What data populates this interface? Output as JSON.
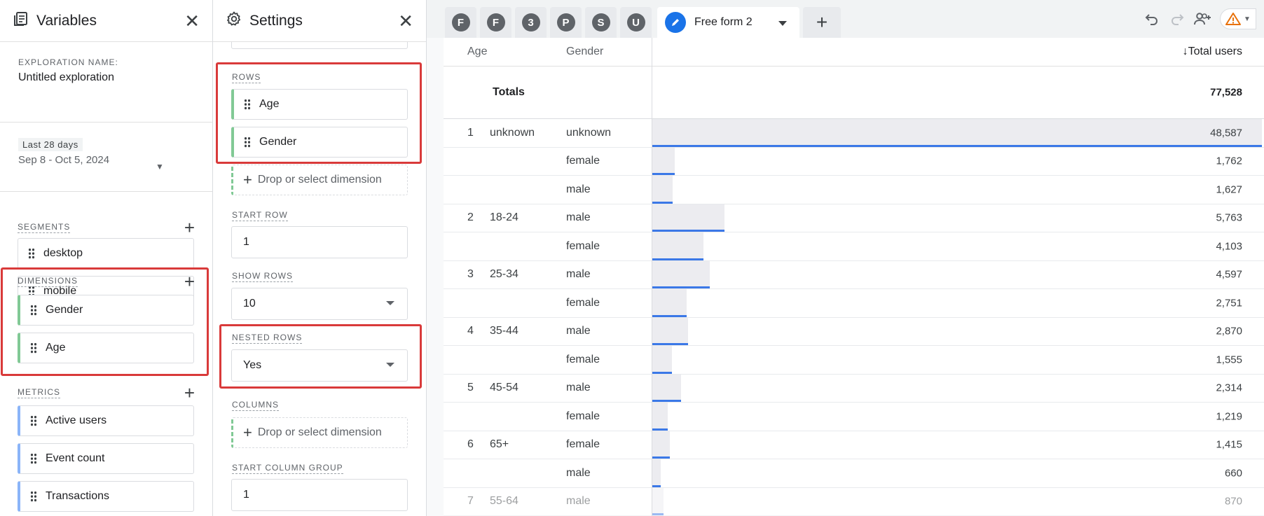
{
  "variables": {
    "title": "Variables",
    "exploration_label": "EXPLORATION NAME:",
    "exploration_name": "Untitled exploration",
    "date_chip": "Last 28 days",
    "date_range": "Sep 8 - Oct 5, 2024",
    "segments_label": "SEGMENTS",
    "segments": [
      "desktop",
      "mobile"
    ],
    "dimensions_label": "DIMENSIONS",
    "dimensions": [
      "Gender",
      "Age"
    ],
    "metrics_label": "METRICS",
    "metrics": [
      "Active users",
      "Event count",
      "Transactions"
    ]
  },
  "settings": {
    "title": "Settings",
    "rows_label": "ROWS",
    "rows": [
      "Age",
      "Gender"
    ],
    "drop_text": "Drop or select dimension",
    "start_row_label": "START ROW",
    "start_row": "1",
    "show_rows_label": "SHOW ROWS",
    "show_rows": "10",
    "nested_rows_label": "NESTED ROWS",
    "nested_rows": "Yes",
    "columns_label": "COLUMNS",
    "start_col_label": "START COLUMN GROUP",
    "start_col": "1"
  },
  "tabs": {
    "letters": [
      "F",
      "F",
      "3",
      "P",
      "S",
      "U"
    ],
    "active_name": "Free form 2"
  },
  "colors": {
    "accent": "#1a73e8",
    "highlight": "#d93a3a",
    "bar": "#3b78e7",
    "dim_green": "#81c995",
    "metric_blue": "#8ab4f8"
  },
  "table": {
    "headers": {
      "age": "Age",
      "gender": "Gender",
      "metric": "Total users"
    },
    "totals_label": "Totals",
    "totals_value": "77,528",
    "max": 48587,
    "rows": [
      {
        "idx": "1",
        "age": "unknown",
        "gender": "unknown",
        "value": "48,587",
        "n": 48587
      },
      {
        "idx": "",
        "age": "",
        "gender": "female",
        "value": "1,762",
        "n": 1762
      },
      {
        "idx": "",
        "age": "",
        "gender": "male",
        "value": "1,627",
        "n": 1627
      },
      {
        "idx": "2",
        "age": "18-24",
        "gender": "male",
        "value": "5,763",
        "n": 5763
      },
      {
        "idx": "",
        "age": "",
        "gender": "female",
        "value": "4,103",
        "n": 4103
      },
      {
        "idx": "3",
        "age": "25-34",
        "gender": "male",
        "value": "4,597",
        "n": 4597
      },
      {
        "idx": "",
        "age": "",
        "gender": "female",
        "value": "2,751",
        "n": 2751
      },
      {
        "idx": "4",
        "age": "35-44",
        "gender": "male",
        "value": "2,870",
        "n": 2870
      },
      {
        "idx": "",
        "age": "",
        "gender": "female",
        "value": "1,555",
        "n": 1555
      },
      {
        "idx": "5",
        "age": "45-54",
        "gender": "male",
        "value": "2,314",
        "n": 2314
      },
      {
        "idx": "",
        "age": "",
        "gender": "female",
        "value": "1,219",
        "n": 1219
      },
      {
        "idx": "6",
        "age": "65+",
        "gender": "female",
        "value": "1,415",
        "n": 1415
      },
      {
        "idx": "",
        "age": "",
        "gender": "male",
        "value": "660",
        "n": 660
      },
      {
        "idx": "7",
        "age": "55-64",
        "gender": "male",
        "value": "870",
        "n": 870
      }
    ]
  }
}
